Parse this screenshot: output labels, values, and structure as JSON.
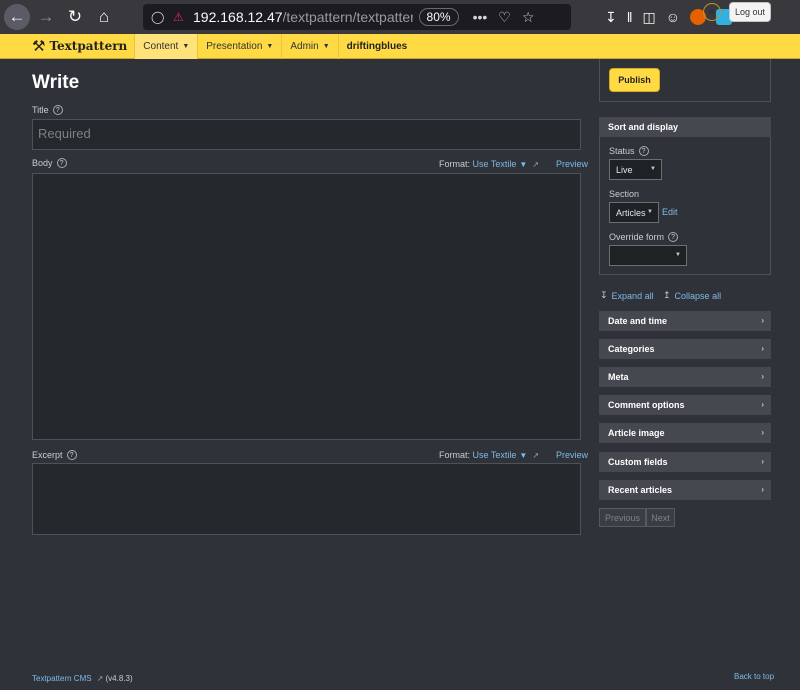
{
  "browser": {
    "url_host": "192.168.12.47",
    "url_path": "/textpattern/textpattern/ind",
    "zoom": "80%"
  },
  "header": {
    "brand": "Textpattern",
    "menu": [
      {
        "label": "Content"
      },
      {
        "label": "Presentation"
      },
      {
        "label": "Admin"
      }
    ],
    "site_name": "driftingblues",
    "logout_label": "Log out"
  },
  "write": {
    "page_title": "Write",
    "title_label": "Title",
    "title_placeholder": "Required",
    "body_label": "Body",
    "excerpt_label": "Excerpt",
    "format_label": "Format:",
    "format_value": "Use Textile",
    "preview_label": "Preview"
  },
  "sidebar": {
    "publish_label": "Publish",
    "sort_display_title": "Sort and display",
    "status_label": "Status",
    "status_value": "Live",
    "section_label": "Section",
    "section_value": "Articles",
    "edit_label": "Edit",
    "override_label": "Override form",
    "override_value": "",
    "expand_all": "Expand all",
    "collapse_all": "Collapse all",
    "panels": [
      {
        "label": "Date and time"
      },
      {
        "label": "Categories"
      },
      {
        "label": "Meta"
      },
      {
        "label": "Comment options"
      },
      {
        "label": "Article image"
      },
      {
        "label": "Custom fields"
      },
      {
        "label": "Recent articles"
      }
    ],
    "previous_label": "Previous",
    "next_label": "Next"
  },
  "footer": {
    "cms_link": "Textpattern CMS",
    "version": "(v4.8.3)",
    "back_to_top": "Back to top"
  }
}
